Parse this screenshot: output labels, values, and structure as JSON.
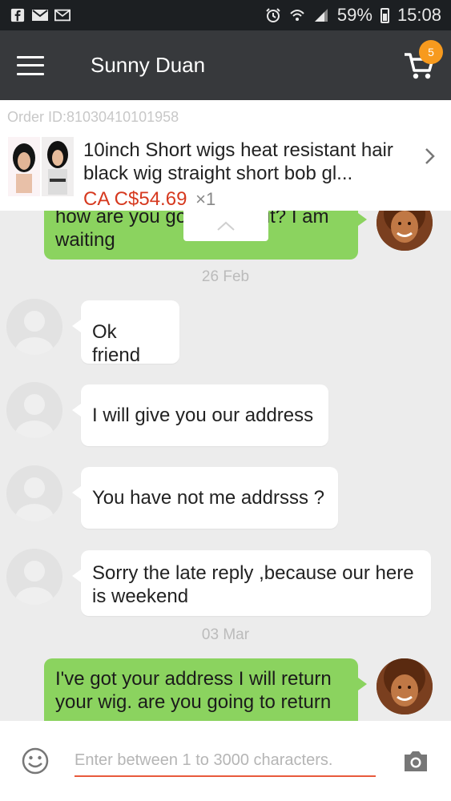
{
  "status_bar": {
    "battery": "59%",
    "time": "15:08",
    "left_icons": [
      "facebook-icon",
      "mail-icon",
      "gmail-icon"
    ],
    "right_icons": [
      "alarm-icon",
      "wifi-icon",
      "signal-icon",
      "battery-icon"
    ],
    "battery_level": 0.59
  },
  "header": {
    "title": "Sunny Duan",
    "cart_count": "5"
  },
  "order": {
    "order_id": "Order ID:81030410101958",
    "product_name": "10inch Short wigs heat resistant hair black wig straight short bob gl...",
    "price": "CA C$54.69",
    "quantity": "×1"
  },
  "messages": [
    {
      "side": "out",
      "text": "how are you go          ve it? I am waiting"
    },
    {
      "type": "date",
      "text": "26 Feb"
    },
    {
      "side": "in",
      "text": "Ok friend"
    },
    {
      "side": "in",
      "text": "I will give you our address"
    },
    {
      "side": "in",
      "text": "You have not me addrsss ?"
    },
    {
      "side": "in",
      "text": "Sorry the late reply ,because our here is weekend"
    },
    {
      "type": "date",
      "text": "03 Mar"
    },
    {
      "side": "out",
      "text": "I've got your address I will return your wig.  are you going to return"
    }
  ],
  "composer": {
    "placeholder": "Enter between 1 to 3000 characters."
  },
  "colors": {
    "appbar": "#37393c",
    "outgoing_bubble": "#8bd35f",
    "badge": "#f79a1e",
    "price": "#d6391f",
    "input_underline": "#e85a3c"
  }
}
